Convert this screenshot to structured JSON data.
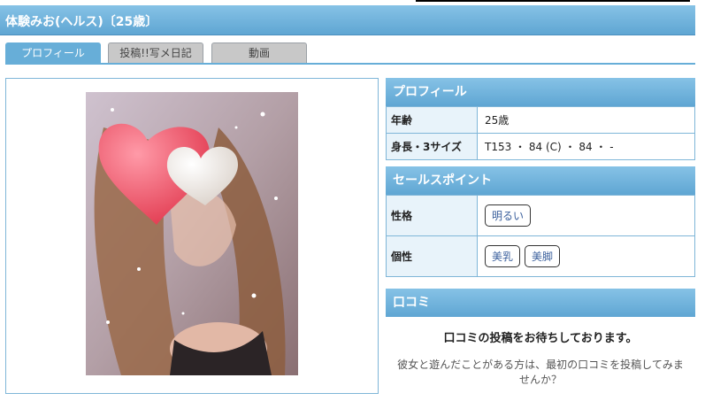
{
  "title": "体験みお(ヘルス)〔25歳〕",
  "tabs": [
    {
      "label": "プロフィール",
      "active": true
    },
    {
      "label": "投稿!!写メ日記",
      "active": false
    },
    {
      "label": "動画",
      "active": false
    }
  ],
  "profile": {
    "heading": "プロフィール",
    "rows": [
      {
        "key": "年齢",
        "value": "25歳"
      },
      {
        "key": "身長・3サイズ",
        "value": "T153 ・ 84 (C) ・ 84 ・ -"
      }
    ]
  },
  "sales": {
    "heading": "セールスポイント",
    "rows": [
      {
        "key": "性格",
        "tags": [
          "明るい"
        ]
      },
      {
        "key": "個性",
        "tags": [
          "美乳",
          "美脚"
        ]
      }
    ]
  },
  "reviews": {
    "heading": "口コミ",
    "empty_title": "口コミの投稿をお待ちしております。",
    "empty_text": "彼女と遊んだことがある方は、最初の口コミを投稿してみませんか？"
  },
  "colors": {
    "accent": "#5fa6d3",
    "tab_inactive": "#c8c8c8",
    "border": "#7fb6d8"
  }
}
